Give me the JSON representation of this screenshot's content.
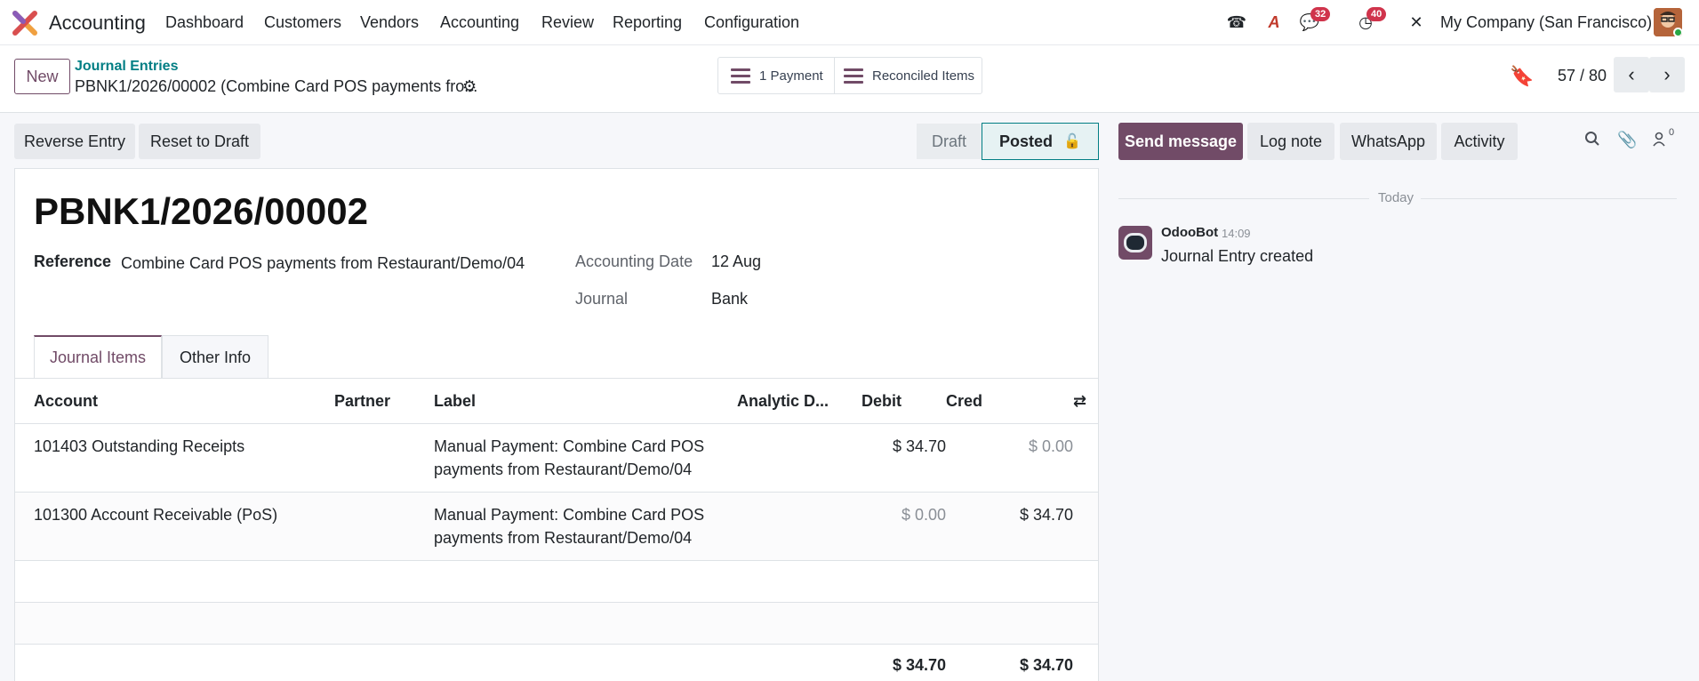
{
  "navbar": {
    "app_name": "Accounting",
    "menu": [
      "Dashboard",
      "Customers",
      "Vendors",
      "Accounting",
      "Review",
      "Reporting",
      "Configuration"
    ],
    "messages_badge": "32",
    "activities_badge": "40",
    "company": "My Company (San Francisco)",
    "icons": [
      "phone-icon",
      "ai-icon",
      "chat-icon",
      "clock-icon",
      "tools-icon"
    ]
  },
  "control": {
    "new_label": "New",
    "breadcrumb_parent": "Journal Entries",
    "breadcrumb_current": "PBNK1/2026/00002 (Combine Card POS payments fro...",
    "smart_payment": "1 Payment",
    "smart_reconciled": "Reconciled Items",
    "pager": "57 / 80"
  },
  "actions": {
    "reverse": "Reverse Entry",
    "reset": "Reset to Draft"
  },
  "status": {
    "draft": "Draft",
    "posted": "Posted"
  },
  "entry": {
    "name": "PBNK1/2026/00002",
    "reference_label": "Reference",
    "reference_value": "Combine Card POS payments from Restaurant/Demo/04",
    "date_label": "Accounting Date",
    "date_value": "12 Aug",
    "journal_label": "Journal",
    "journal_value": "Bank"
  },
  "tabs": [
    "Journal Items",
    "Other Info"
  ],
  "table": {
    "headers": [
      "Account",
      "Partner",
      "Label",
      "Analytic D...",
      "Debit",
      "Cred"
    ],
    "rows": [
      {
        "account": "101403 Outstanding Receipts",
        "partner": "",
        "label": "Manual Payment: Combine Card POS payments from Restaurant/Demo/04",
        "analytic": "",
        "debit": "$ 34.70",
        "credit": "$ 0.00"
      },
      {
        "account": "101300 Account Receivable (PoS)",
        "partner": "",
        "label": "Manual Payment: Combine Card POS payments from Restaurant/Demo/04",
        "analytic": "",
        "debit": "$ 0.00",
        "credit": "$ 34.70"
      }
    ],
    "total_debit": "$ 34.70",
    "total_credit": "$ 34.70"
  },
  "chatter": {
    "send_message": "Send message",
    "log_note": "Log note",
    "whatsapp": "WhatsApp",
    "activity": "Activity",
    "followers_count": "0",
    "today": "Today",
    "author": "OdooBot",
    "time": "14:09",
    "message": "Journal Entry created"
  }
}
